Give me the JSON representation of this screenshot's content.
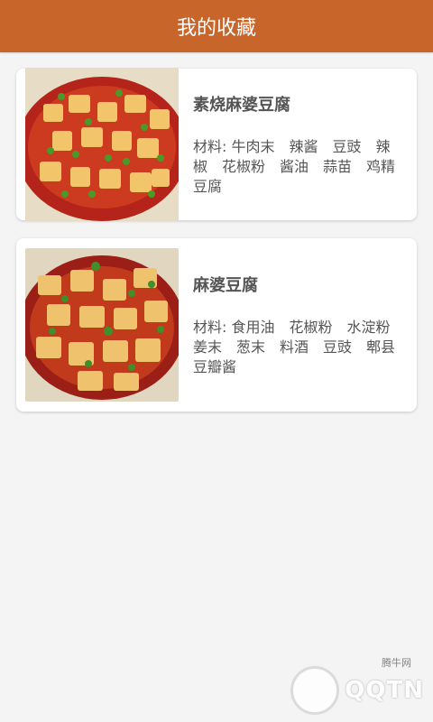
{
  "header": {
    "title": "我的收藏"
  },
  "favorites": [
    {
      "name": "素烧麻婆豆腐",
      "ingredients": "材料: 牛肉末　辣酱　豆豉　辣椒　花椒粉　酱油　蒜苗　鸡精　豆腐",
      "image_icon": "mapo-tofu-photo"
    },
    {
      "name": "麻婆豆腐",
      "ingredients": "材料: 食用油　花椒粉　水淀粉　姜末　葱末　料酒　豆豉　郫县豆瓣酱",
      "image_icon": "mapo-tofu-photo"
    }
  ],
  "watermark": {
    "text": "QQTN",
    "site": "腾牛网"
  },
  "colors": {
    "header_bg": "#c8652a",
    "page_bg": "#f4f4f4"
  }
}
